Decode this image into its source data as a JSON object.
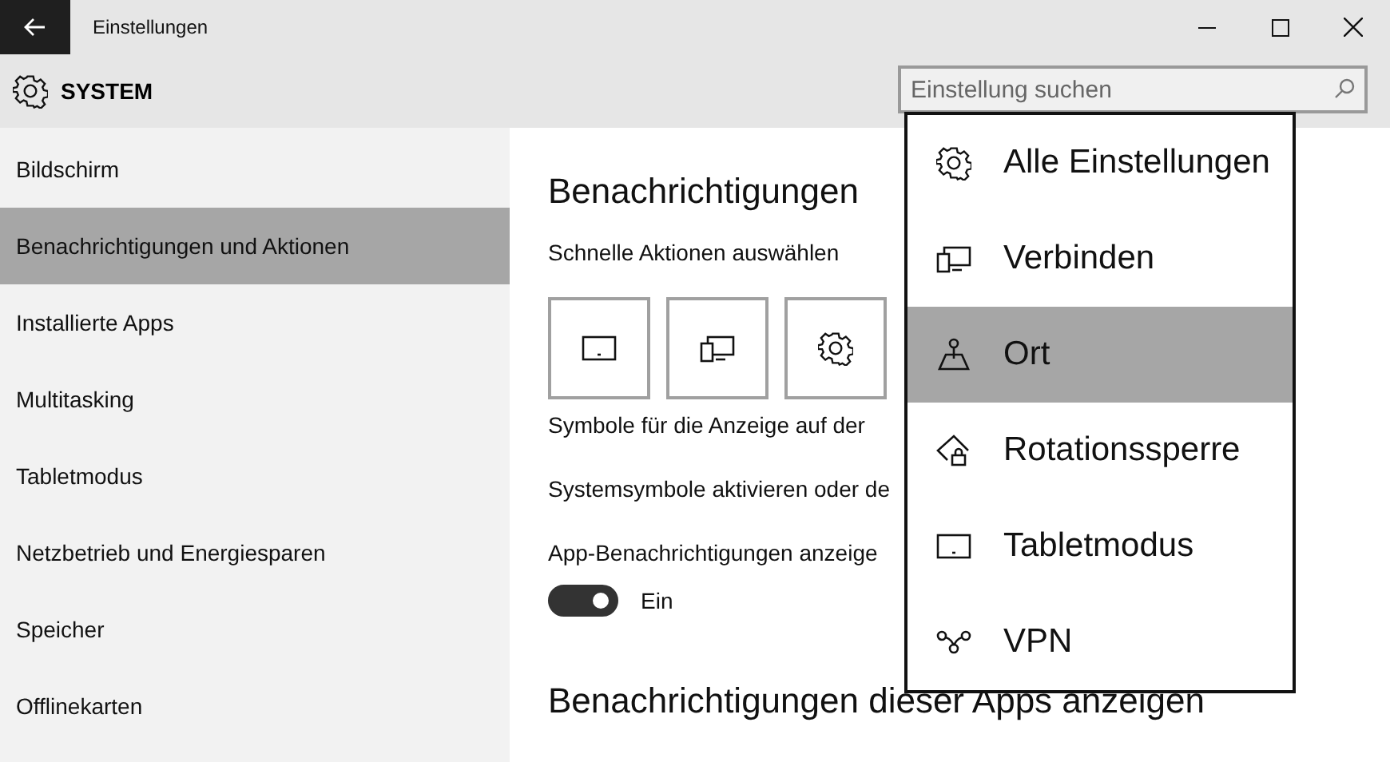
{
  "window": {
    "title": "Einstellungen"
  },
  "header": {
    "title": "SYSTEM",
    "search": {
      "placeholder": "Einstellung suchen"
    }
  },
  "sidebar": {
    "items": [
      {
        "label": "Bildschirm",
        "selected": false
      },
      {
        "label": "Benachrichtigungen und Aktionen",
        "selected": true
      },
      {
        "label": "Installierte Apps",
        "selected": false
      },
      {
        "label": "Multitasking",
        "selected": false
      },
      {
        "label": "Tabletmodus",
        "selected": false
      },
      {
        "label": "Netzbetrieb und Energiesparen",
        "selected": false
      },
      {
        "label": "Speicher",
        "selected": false
      },
      {
        "label": "Offlinekarten",
        "selected": false
      }
    ]
  },
  "content": {
    "heading": "Benachrichtigungen",
    "subheading": "Schnelle Aktionen auswählen",
    "tiles": [
      {
        "kind": "tablet"
      },
      {
        "kind": "connect"
      },
      {
        "kind": "settings"
      }
    ],
    "lines": [
      "Symbole für die Anzeige auf der",
      "Systemsymbole aktivieren oder de",
      "App-Benachrichtigungen anzeige"
    ],
    "toggle": {
      "on": true,
      "label": "Ein"
    },
    "heading_2": "Benachrichtigungen dieser Apps anzeigen"
  },
  "dropdown": {
    "items": [
      {
        "kind": "settings",
        "label": "Alle Einstellungen",
        "selected": false
      },
      {
        "kind": "connect",
        "label": "Verbinden",
        "selected": false
      },
      {
        "kind": "location",
        "label": "Ort",
        "selected": true
      },
      {
        "kind": "rotation",
        "label": "Rotationssperre",
        "selected": false
      },
      {
        "kind": "tablet",
        "label": "Tabletmodus",
        "selected": false
      },
      {
        "kind": "vpn",
        "label": "VPN",
        "selected": false
      }
    ]
  }
}
